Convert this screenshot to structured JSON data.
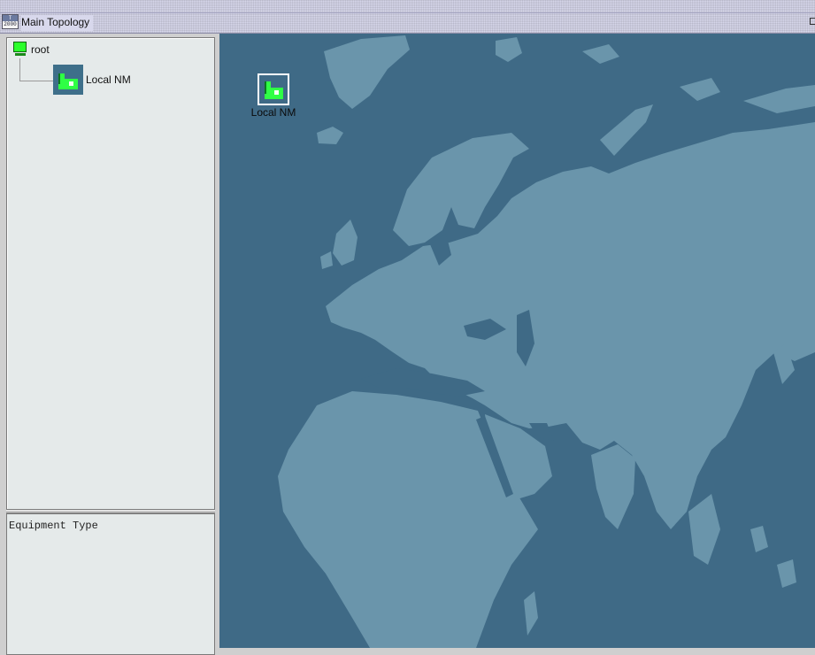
{
  "window": {
    "title": "Main Topology",
    "app_icon_text_top": "T",
    "app_icon_text_bottom": "2000"
  },
  "tree": {
    "root": {
      "label": "root",
      "icon": "monitor-icon"
    },
    "children": [
      {
        "label": "Local NM",
        "icon": "network-manager-icon"
      }
    ]
  },
  "info_panel": {
    "text": "Equipment Type"
  },
  "map": {
    "nodes": [
      {
        "label": "Local NM",
        "icon": "network-manager-icon"
      }
    ],
    "colors": {
      "ocean": "#3f6a86",
      "land": "#6a95ab",
      "node_green": "#2fff45"
    }
  }
}
